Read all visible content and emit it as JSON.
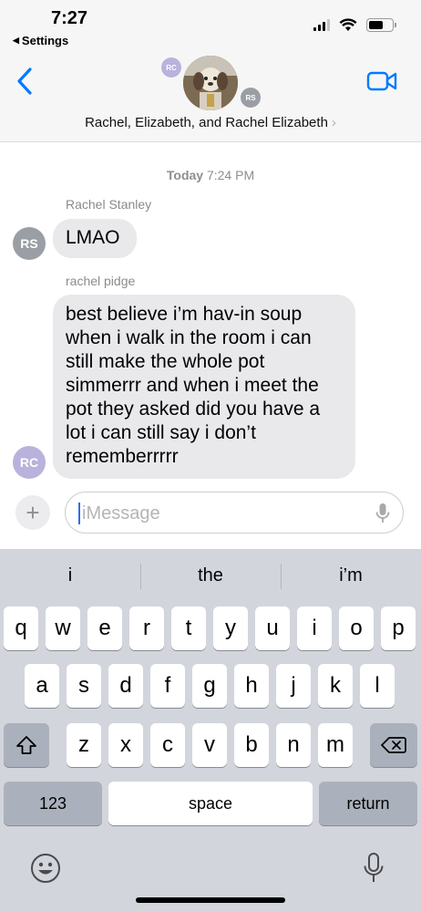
{
  "status_bar": {
    "time": "7:27",
    "back_app": "Settings"
  },
  "conversation": {
    "title": "Rachel, Elizabeth, and Rachel Elizabeth",
    "participants_initials": [
      "RC",
      "RS"
    ]
  },
  "messages": {
    "timestamp_day": "Today",
    "timestamp_time": "7:24 PM",
    "items": [
      {
        "sender": "Rachel Stanley",
        "initials": "RS",
        "text": "LMAO"
      },
      {
        "sender": "rachel pidge",
        "initials": "RC",
        "text": "best believe i’m hav-in soup when i walk in the room i can still make the whole pot simmerrr and when i meet the pot they asked did you have a lot i can still say i don’t rememberrrrr"
      }
    ]
  },
  "composer": {
    "placeholder": "iMessage",
    "plus": "+"
  },
  "keyboard": {
    "suggestions": [
      "i",
      "the",
      "i’m"
    ],
    "row1": [
      "q",
      "w",
      "e",
      "r",
      "t",
      "y",
      "u",
      "i",
      "o",
      "p"
    ],
    "row2": [
      "a",
      "s",
      "d",
      "f",
      "g",
      "h",
      "j",
      "k",
      "l"
    ],
    "row3": [
      "z",
      "x",
      "c",
      "v",
      "b",
      "n",
      "m"
    ],
    "numbers_key": "123",
    "space_key": "space",
    "return_key": "return"
  },
  "icons": {
    "back": "chevron-left-icon",
    "video": "video-camera-icon",
    "mic": "microphone-icon",
    "emoji": "emoji-icon",
    "shift": "shift-icon",
    "delete": "backspace-icon"
  },
  "colors": {
    "accent": "#007aff",
    "incoming_bubble": "#e9e9eb",
    "keyboard_bg": "#d2d5dc"
  }
}
